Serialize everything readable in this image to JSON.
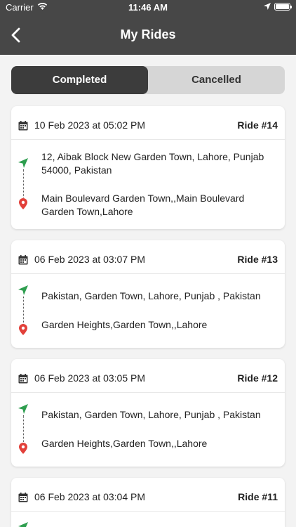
{
  "status_bar": {
    "carrier": "Carrier",
    "time": "11:46 AM"
  },
  "header": {
    "title": "My Rides",
    "back_icon": "chevron-left-icon"
  },
  "tabs": [
    {
      "label": "Completed",
      "selected": true
    },
    {
      "label": "Cancelled",
      "selected": false
    }
  ],
  "rides": [
    {
      "date": "10 Feb 2023 at 05:02 PM",
      "ride_no": "Ride #14",
      "pickup": "12, Aibak Block New Garden Town, Lahore, Punjab 54000, Pakistan",
      "dropoff": "Main Boulevard Garden Town,,Main Boulevard Garden Town,Lahore"
    },
    {
      "date": "06 Feb 2023 at 03:07 PM",
      "ride_no": "Ride #13",
      "pickup": "Pakistan, Garden Town, Lahore, Punjab , Pakistan",
      "dropoff": "Garden Heights,Garden Town,,Lahore"
    },
    {
      "date": "06 Feb 2023 at 03:05 PM",
      "ride_no": "Ride #12",
      "pickup": "Pakistan, Garden Town, Lahore, Punjab , Pakistan",
      "dropoff": "Garden Heights,Garden Town,,Lahore"
    },
    {
      "date": "06 Feb 2023 at 03:04 PM",
      "ride_no": "Ride #11",
      "pickup": "",
      "dropoff": ""
    }
  ],
  "colors": {
    "header": "#474747",
    "tab_active": "#3c3c3c",
    "pickup": "#2e9e4f",
    "dropoff": "#e2403a"
  }
}
